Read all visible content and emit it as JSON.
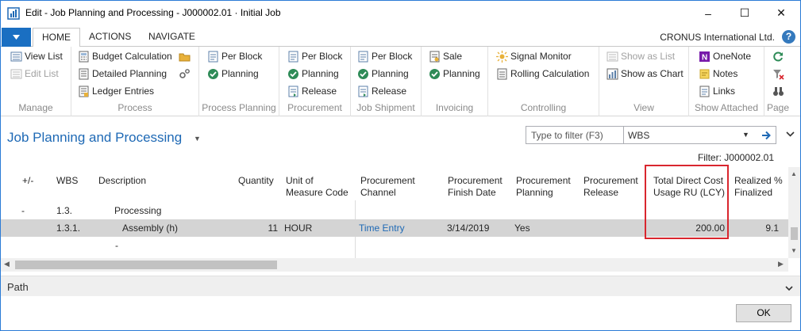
{
  "window": {
    "title": "Edit - Job Planning and Processing - J000002.01 · Initial Job",
    "minimize": "–",
    "maximize": "☐",
    "close": "✕"
  },
  "ribbon_tabs": {
    "tabs": [
      "HOME",
      "ACTIONS",
      "NAVIGATE"
    ],
    "company": "CRONUS International Ltd.",
    "help": "?"
  },
  "ribbon": {
    "manage": {
      "label": "Manage",
      "items": [
        "View List",
        "Edit List"
      ]
    },
    "process": {
      "label": "Process",
      "items": [
        "Budget Calculation",
        "Detailed Planning",
        "Ledger Entries"
      ]
    },
    "process_planning": {
      "label": "Process Planning",
      "items": [
        "Per Block",
        "Planning"
      ]
    },
    "procurement": {
      "label": "Procurement",
      "items": [
        "Per Block",
        "Planning",
        "Release"
      ]
    },
    "job_shipment": {
      "label": "Job Shipment",
      "items": [
        "Per Block",
        "Planning",
        "Release"
      ]
    },
    "invoicing": {
      "label": "Invoicing",
      "items": [
        "Sale",
        "Planning"
      ]
    },
    "controlling": {
      "label": "Controlling",
      "items": [
        "Signal Monitor",
        "Rolling Calculation"
      ]
    },
    "view": {
      "label": "View",
      "items": [
        "Show as List",
        "Show as Chart"
      ]
    },
    "show_attached": {
      "label": "Show Attached",
      "items": [
        "OneNote",
        "Notes",
        "Links"
      ]
    },
    "page": {
      "label": "Page"
    }
  },
  "header": {
    "page_title": "Job Planning and Processing",
    "filter_placeholder": "Type to filter (F3)",
    "filter_field": "WBS",
    "filter_info": "Filter: J000002.01"
  },
  "grid": {
    "columns": [
      {
        "key": "toggle",
        "label": "+/-"
      },
      {
        "key": "wbs",
        "label": "WBS"
      },
      {
        "key": "description",
        "label": "Description"
      },
      {
        "key": "quantity",
        "label": "Quantity"
      },
      {
        "key": "uom",
        "label": "Unit of\nMeasure Code"
      },
      {
        "key": "proc_channel",
        "label": "Procurement\nChannel"
      },
      {
        "key": "proc_finish",
        "label": "Procurement\nFinish Date"
      },
      {
        "key": "proc_planning",
        "label": "Procurement\nPlanning"
      },
      {
        "key": "proc_release",
        "label": "Procurement\nRelease"
      },
      {
        "key": "total_direct_cost",
        "label": "Total Direct Cost\nUsage RU (LCY)"
      },
      {
        "key": "realized",
        "label": "Realized %\nFinalized"
      }
    ],
    "rows": [
      {
        "toggle": "-",
        "wbs": "1.3.",
        "description": "Processing",
        "quantity": "",
        "uom": "",
        "proc_channel": "",
        "proc_finish": "",
        "proc_planning": "",
        "proc_release": "",
        "total_direct_cost": "",
        "realized": ""
      },
      {
        "toggle": "",
        "wbs": "1.3.1.",
        "description": "Assembly (h)",
        "quantity": "11",
        "uom": "HOUR",
        "proc_channel": "Time Entry",
        "proc_finish": "3/14/2019",
        "proc_planning": "Yes",
        "proc_release": "",
        "total_direct_cost": "200.00",
        "realized": "9.1"
      },
      {
        "toggle": "",
        "wbs": "",
        "description": "-",
        "quantity": "",
        "uom": "",
        "proc_channel": "",
        "proc_finish": "",
        "proc_planning": "",
        "proc_release": "",
        "total_direct_cost": "",
        "realized": ""
      }
    ]
  },
  "path": {
    "label": "Path"
  },
  "footer": {
    "ok": "OK"
  },
  "colors": {
    "accent": "#1e69b5",
    "highlight": "#d9262e",
    "selected_row": "#d4d4d4"
  }
}
